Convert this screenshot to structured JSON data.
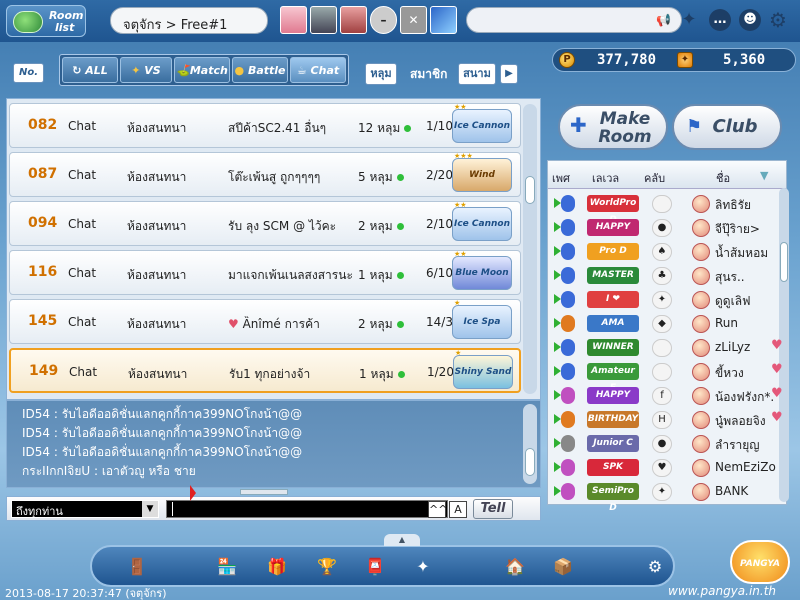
{
  "header": {
    "roomlist_label_1": "Room",
    "roomlist_label_2": "list",
    "channel": "จตุจักร > Free#1",
    "search_icon": "megaphone-icon",
    "top_icons": [
      "sparkle-icon",
      "chat-icon",
      "skull-icon",
      "gear-icon"
    ]
  },
  "tabs": {
    "no": "No.",
    "all": "ALL",
    "vs": "VS",
    "match": "Match",
    "battle": "Battle",
    "chat": "Chat",
    "sort_member": "หลุม",
    "member_label": "สมาชิก",
    "sort_field": "สนาม",
    "next": "▶"
  },
  "money": {
    "pang": "377,780",
    "cookie": "5,360"
  },
  "rooms": [
    {
      "num": "082",
      "type": "Chat",
      "name": "ห้องสนทนา",
      "title": "สปีค้าSC2.41 อื่นๆ",
      "holes": "12 หลุม",
      "players": "1/10",
      "course": "Ice Cannon"
    },
    {
      "num": "087",
      "type": "Chat",
      "name": "ห้องสนทนา",
      "title": "โต๊ะเพ้นสู ถูกๆๆๆๆ",
      "holes": "5 หลุม",
      "players": "2/20",
      "course": "Wind"
    },
    {
      "num": "094",
      "type": "Chat",
      "name": "ห้องสนทนา",
      "title": "รับ ลุง SCM @ ไว้คะ",
      "holes": "2 หลุม",
      "players": "2/10",
      "course": "Ice Cannon"
    },
    {
      "num": "116",
      "type": "Chat",
      "name": "ห้องสนทนา",
      "title": "มาแจกเพ้นเนลสงสารนะ",
      "holes": "1 หลุม",
      "players": "6/10",
      "course": "Blue Moon"
    },
    {
      "num": "145",
      "type": "Chat",
      "name": "ห้องสนทนา",
      "title": "Ȁnîmé การค้า",
      "holes": "2 หลุม",
      "players": "14/30",
      "course": "Ice Spa"
    },
    {
      "num": "149",
      "type": "Chat",
      "name": "ห้องสนทนา",
      "title": "รับ1 ทุกอย่างจ้า",
      "holes": "1 หลุม",
      "players": "1/20",
      "course": "Shiny Sand"
    }
  ],
  "chat": {
    "lines": [
      "ID54 : รับไอดีออดิชั่นแลกคูกกี้กาค399NOโกงน้า@@",
      "ID54 : รับไอดีออดิชั่นแลกคูกกี้กาค399NOโกงน้า@@",
      "ID54 : รับไอดีออดิชั่นแลกคูกกี้กาค399NOโกงน้า@@",
      "กระIIกกIจิยU : เอาตัวญู หรือ ชาย"
    ],
    "target": "ถึงทุกท่าน",
    "font_big": "^^",
    "font_a": "A",
    "tell": "Tell"
  },
  "right": {
    "make_room_1": "Make",
    "make_room_2": "Room",
    "club": "Club",
    "col_gender": "เพศ",
    "col_level": "เลเวล",
    "col_club": "คลับ",
    "col_name": "ชื่อ",
    "users": [
      {
        "title": "WorldPro D",
        "club": "",
        "name": "ลิทธิรัย",
        "extra": ""
      },
      {
        "title": "HAPPY",
        "club": "●",
        "name": "จีปุ๊ริาย>",
        "extra": ""
      },
      {
        "title": "Pro D",
        "club": "♠",
        "name": "น้ำส้มหอม",
        "extra": ""
      },
      {
        "title": "MASTER",
        "club": "♣",
        "name": "สุนร..",
        "extra": ""
      },
      {
        "title": "I ❤",
        "club": "✦",
        "name": "ดูดูเลิฟ",
        "extra": ""
      },
      {
        "title": "AMA",
        "club": "◆",
        "name": "Run",
        "extra": ""
      },
      {
        "title": "WINNER",
        "club": "",
        "name": "zLiLyz",
        "extra": "♥"
      },
      {
        "title": "Amateur E",
        "club": "",
        "name": "ขี้หวง",
        "extra": "♥"
      },
      {
        "title": "HAPPY",
        "club": "f",
        "name": "น้องฟรังก*.",
        "extra": "♥"
      },
      {
        "title": "BIRTHDAY",
        "club": "H",
        "name": "นู๋พลอยจิง",
        "extra": "♥"
      },
      {
        "title": "Junior C",
        "club": "●",
        "name": "ลำรายุญ",
        "extra": ""
      },
      {
        "title": "SPK",
        "club": "♥",
        "name": "NemEziZo",
        "extra": ""
      },
      {
        "title": "SemiPro D",
        "club": "✦",
        "name": "BANK",
        "extra": ""
      }
    ]
  },
  "footer": {
    "datetime": "2013-08-17 20:37:47 (จตุจักร)",
    "site": "www.pangya.in.th",
    "logo": "PANGYA"
  }
}
